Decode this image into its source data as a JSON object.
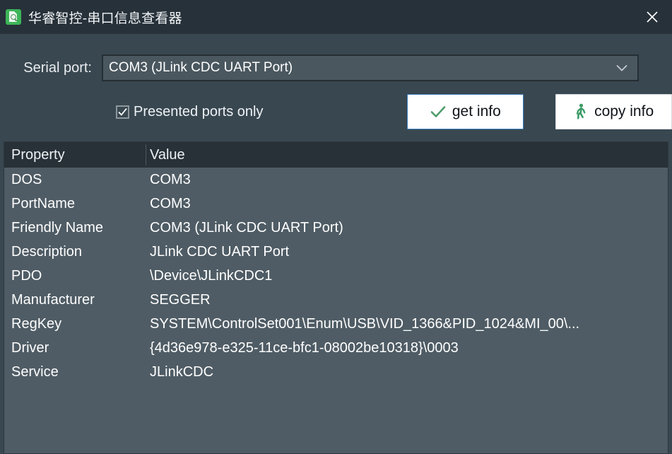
{
  "window": {
    "title": "华睿智控-串口信息查看器",
    "app_icon": "document-search-icon",
    "close_label": "×"
  },
  "form": {
    "port_label": "Serial port:",
    "port_value": "COM3 (JLink CDC UART Port)",
    "port_dropdown_icon": "chevron-down-icon",
    "checkbox_label": "Presented ports only",
    "checkbox_checked": "true",
    "get_info_label": "get info",
    "get_info_icon": "check-icon",
    "copy_info_label": "copy info",
    "copy_info_icon": "walking-person-icon"
  },
  "table": {
    "columns": [
      "Property",
      "Value"
    ],
    "rows": [
      {
        "property": "DOS",
        "value": "COM3"
      },
      {
        "property": "PortName",
        "value": "COM3"
      },
      {
        "property": "Friendly Name",
        "value": "COM3 (JLink CDC UART Port)"
      },
      {
        "property": "Description",
        "value": "JLink CDC UART Port"
      },
      {
        "property": "PDO",
        "value": "\\Device\\JLinkCDC1"
      },
      {
        "property": "Manufacturer",
        "value": "SEGGER"
      },
      {
        "property": "RegKey",
        "value": "SYSTEM\\ControlSet001\\Enum\\USB\\VID_1366&PID_1024&MI_00\\..."
      },
      {
        "property": "Driver",
        "value": "{4d36e978-e325-11ce-bfc1-08002be10318}\\0003"
      },
      {
        "property": "Service",
        "value": "JLinkCDC"
      }
    ]
  },
  "colors": {
    "window_bg": "#394750",
    "titlebar_bg": "#27313a",
    "accent_green": "#3cb557",
    "table_header_bg": "#283137",
    "table_row_bg": "#4f5c65",
    "focus_blue": "#3a7ebf"
  }
}
